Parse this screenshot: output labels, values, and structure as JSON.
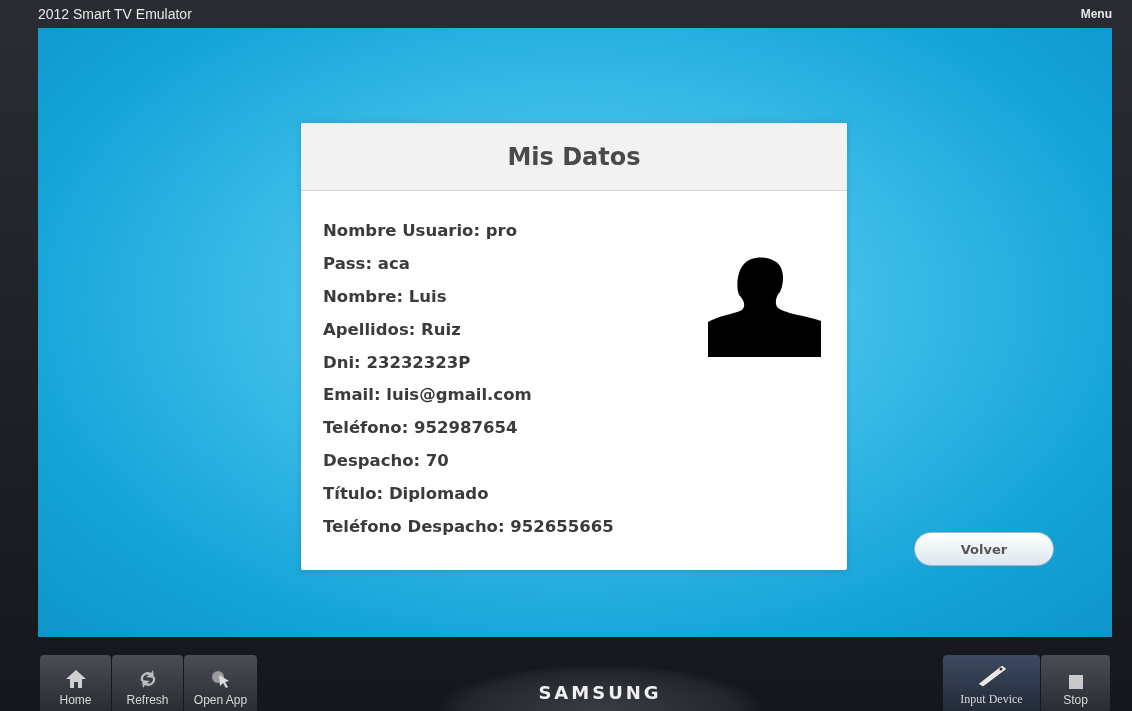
{
  "window": {
    "title": "2012 Smart TV Emulator",
    "menu": "Menu"
  },
  "card": {
    "title": "Mis Datos",
    "fields": [
      "Nombre Usuario: pro",
      "Pass: aca",
      "Nombre: Luis",
      "Apellidos: Ruiz",
      "Dni: 23232323P",
      "Email: luis@gmail.com",
      "Teléfono: 952987654",
      "Despacho: 70",
      "Título: Diplomado",
      "Teléfono Despacho: 952655665"
    ]
  },
  "back_button": "Volver",
  "left_buttons": [
    {
      "kind": "home",
      "label": "Home"
    },
    {
      "kind": "refresh",
      "label": "Refresh"
    },
    {
      "kind": "open",
      "label": "Open App"
    }
  ],
  "brand": "SAMSUNG",
  "right_buttons": [
    {
      "kind": "input",
      "label": "Input Device"
    },
    {
      "kind": "stop",
      "label": "Stop"
    }
  ]
}
